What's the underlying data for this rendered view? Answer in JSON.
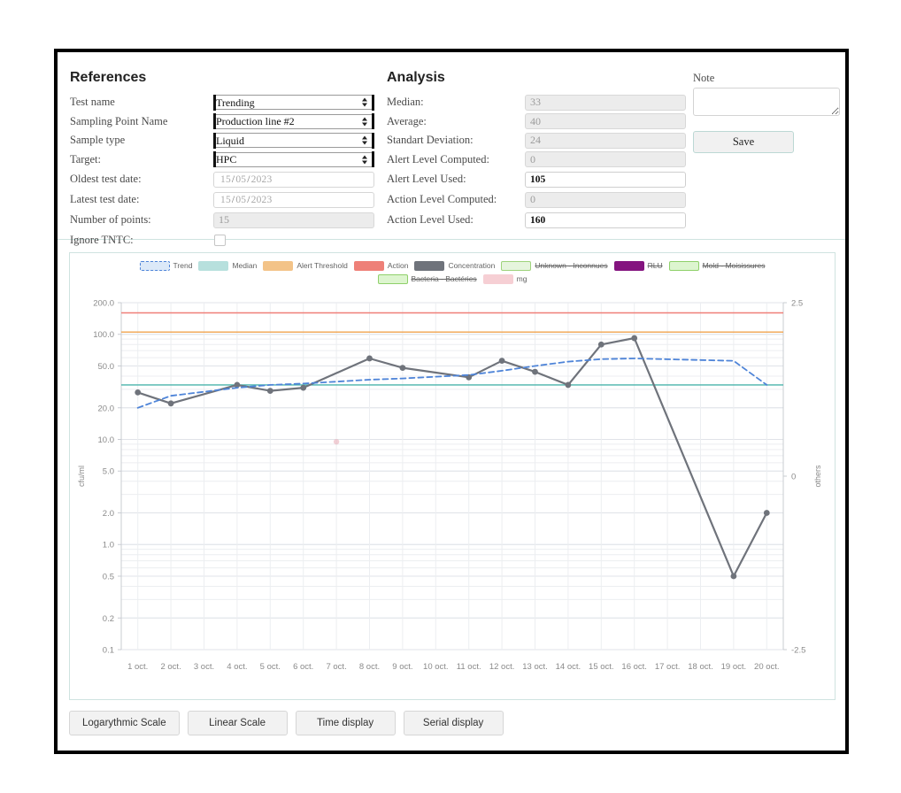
{
  "references": {
    "title": "References",
    "fields": [
      {
        "label": "Test name",
        "type": "select",
        "value": "Trending"
      },
      {
        "label": "Sampling Point Name",
        "type": "select",
        "value": "Production line #2"
      },
      {
        "label": "Sample type",
        "type": "select",
        "value": "Liquid"
      },
      {
        "label": "Target:",
        "type": "select",
        "value": "HPC"
      },
      {
        "label": "Oldest test date:",
        "type": "date",
        "day": "15",
        "month": "05",
        "year": "2023"
      },
      {
        "label": "Latest test date:",
        "type": "date",
        "day": "15",
        "month": "05",
        "year": "2023"
      },
      {
        "label": "Number of points:",
        "type": "readonly",
        "value": "15"
      },
      {
        "label": "Ignore TNTC:",
        "type": "checkbox",
        "checked": false
      }
    ]
  },
  "analysis": {
    "title": "Analysis",
    "fields": [
      {
        "label": "Median:",
        "value": "33",
        "readonly": true
      },
      {
        "label": "Average:",
        "value": "40",
        "readonly": true
      },
      {
        "label": "Standart Deviation:",
        "value": "24",
        "readonly": true
      },
      {
        "label": "Alert Level Computed:",
        "value": "0",
        "readonly": true
      },
      {
        "label": "Alert Level Used:",
        "value": "105",
        "readonly": false
      },
      {
        "label": "Action Level Computed:",
        "value": "0",
        "readonly": true
      },
      {
        "label": "Action Level Used:",
        "value": "160",
        "readonly": false
      }
    ]
  },
  "note": {
    "label": "Note",
    "value": "",
    "save_label": "Save"
  },
  "buttons": [
    {
      "label": "Logarythmic Scale"
    },
    {
      "label": "Linear Scale"
    },
    {
      "label": "Time display"
    },
    {
      "label": "Serial display"
    }
  ],
  "chart_data": {
    "type": "line",
    "title": "",
    "xlabel": "",
    "ylabel": "cfu/ml",
    "y2label": "others",
    "yscale": "log",
    "ylim": [
      0.1,
      200
    ],
    "yticks": [
      200.0,
      100.0,
      50.0,
      20.0,
      10.0,
      5.0,
      2.0,
      1.0,
      0.5,
      0.2,
      0.1
    ],
    "ytick_labels": [
      "200.0",
      "100.0",
      "50.0",
      "20.0",
      "10.0",
      "5.0",
      "2.0",
      "1.0",
      "0.5",
      "0.2",
      "0.1"
    ],
    "y2lim": [
      -2.5,
      2.5
    ],
    "y2ticks": [
      2.5,
      0,
      -2.5
    ],
    "y2tick_labels": [
      "2.5",
      "0",
      "-2.5"
    ],
    "categories": [
      "1 oct.",
      "2 oct.",
      "3 oct.",
      "4 oct.",
      "5 oct.",
      "6 oct.",
      "7 oct.",
      "8 oct.",
      "9 oct.",
      "10 oct.",
      "11 oct.",
      "12 oct.",
      "13 oct.",
      "14 oct.",
      "15 oct.",
      "16 oct.",
      "17 oct.",
      "18 oct.",
      "19 oct.",
      "20 oct."
    ],
    "grid": true,
    "legend_position": "top",
    "legend": [
      {
        "label": "Trend",
        "color": "#dce9f8",
        "border": "#4e84d8",
        "style": "dashed",
        "struck": false
      },
      {
        "label": "Median",
        "color": "#b7e0dd",
        "border": "#b7e0dd",
        "style": "solid",
        "struck": false
      },
      {
        "label": "Alert Threshold",
        "color": "#f3c388",
        "border": "#f3c388",
        "style": "solid",
        "struck": false
      },
      {
        "label": "Action",
        "color": "#ee8078",
        "border": "#ee8078",
        "style": "solid",
        "struck": false
      },
      {
        "label": "Concentration",
        "color": "#6f737b",
        "border": "#6f737b",
        "style": "solid",
        "struck": false
      },
      {
        "label": "Unknown - Inconnues",
        "color": "#e6f5dd",
        "border": "#9ed37c",
        "style": "solid",
        "struck": true
      },
      {
        "label": "RLU",
        "color": "#84147f",
        "border": "#84147f",
        "style": "solid",
        "struck": true
      },
      {
        "label": "Mold - Moisissures",
        "color": "#ddf5cf",
        "border": "#8fd06a",
        "style": "solid",
        "struck": true
      },
      {
        "label": "Bacteria - Bactéries",
        "color": "#ddf5cf",
        "border": "#8fd06a",
        "style": "solid",
        "struck": true
      },
      {
        "label": "mg",
        "color": "#f6cfd4",
        "border": "#f6cfd4",
        "style": "solid",
        "struck": false
      }
    ],
    "series": [
      {
        "name": "Concentration",
        "color": "#6f737b",
        "style": "solid",
        "x": [
          "1 oct.",
          "2 oct.",
          "4 oct.",
          "5 oct.",
          "6 oct.",
          "8 oct.",
          "9 oct.",
          "11 oct.",
          "12 oct.",
          "13 oct.",
          "14 oct.",
          "15 oct.",
          "16 oct.",
          "19 oct.",
          "20 oct."
        ],
        "values": [
          28,
          22,
          33,
          29,
          31,
          59,
          48,
          39,
          56,
          44,
          33,
          80,
          92,
          0.5,
          2.0
        ]
      },
      {
        "name": "Trend",
        "color": "#4e84d8",
        "style": "dashed",
        "x": [
          "1 oct.",
          "2 oct.",
          "4 oct.",
          "5 oct.",
          "6 oct.",
          "8 oct.",
          "9 oct.",
          "11 oct.",
          "12 oct.",
          "13 oct.",
          "14 oct.",
          "15 oct.",
          "16 oct.",
          "19 oct.",
          "20 oct."
        ],
        "values": [
          20,
          26,
          31,
          33,
          34,
          37,
          38,
          41,
          45,
          50,
          55,
          58,
          59,
          56,
          33
        ]
      },
      {
        "name": "mg",
        "color": "#e7a9b4",
        "style": "point",
        "x": [
          "7 oct."
        ],
        "values": [
          9.5
        ]
      }
    ],
    "threshold_lines": [
      {
        "name": "Action",
        "value": 160,
        "color": "#ef7f78"
      },
      {
        "name": "Alert Threshold",
        "value": 105,
        "color": "#f0a34e"
      },
      {
        "name": "Median",
        "value": 33,
        "color": "#49b4ac"
      }
    ]
  }
}
